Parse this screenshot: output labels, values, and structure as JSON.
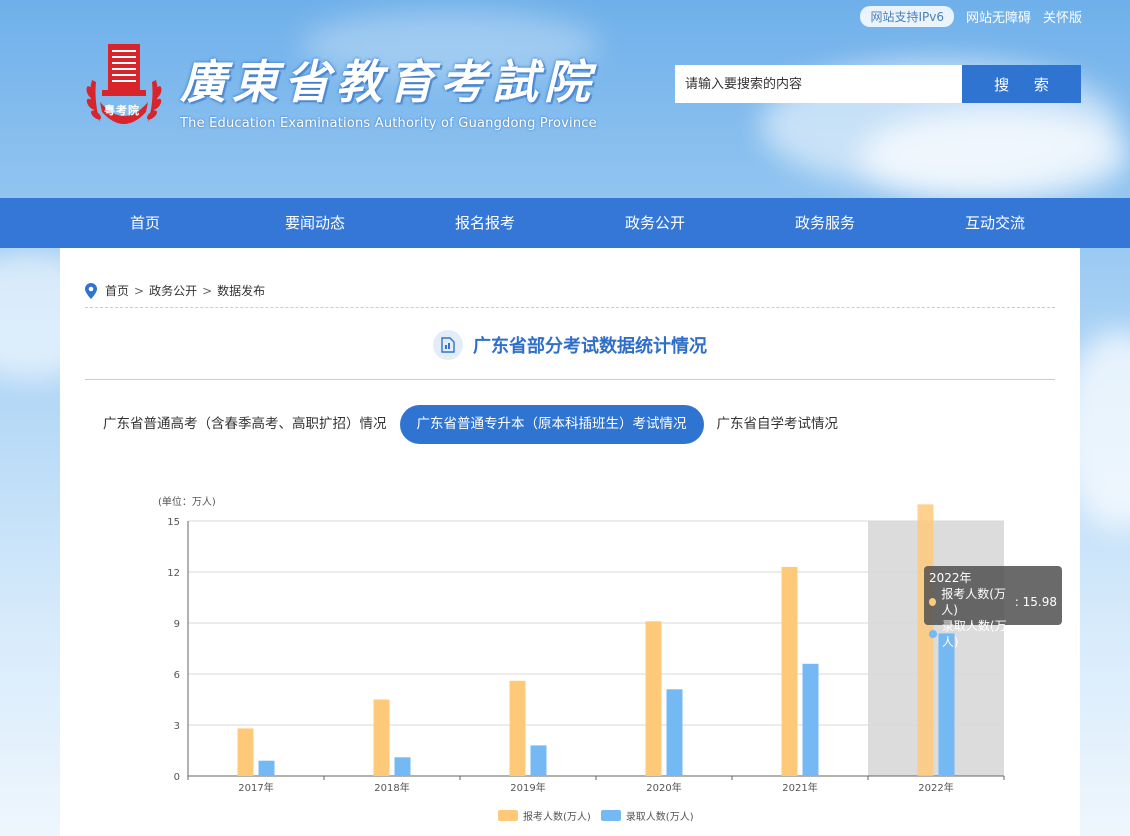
{
  "top_links": {
    "ipv6": "网站支持IPv6",
    "accessibility": "网站无障碍",
    "elderly": "关怀版"
  },
  "brand": {
    "seal_text": "粤考院",
    "name_cn": "廣東省教育考試院",
    "name_en": "The Education Examinations Authority of Guangdong Province"
  },
  "search": {
    "placeholder": "请输入要搜索的内容",
    "button": "搜 索"
  },
  "nav": {
    "items": [
      "首页",
      "要闻动态",
      "报名报考",
      "政务公开",
      "政务服务",
      "互动交流"
    ]
  },
  "breadcrumb": {
    "items": [
      "首页",
      "政务公开",
      "数据发布"
    ],
    "separator": ">"
  },
  "page": {
    "title": "广东省部分考试数据统计情况"
  },
  "tabs": [
    {
      "label": "广东省普通高考（含春季高考、高职扩招）情况",
      "active": false
    },
    {
      "label": "广东省普通专升本（原本科插班生）考试情况",
      "active": true
    },
    {
      "label": "广东省自学考试情况",
      "active": false
    }
  ],
  "colors": {
    "nav": "#3477d6",
    "accent": "#2f74d0",
    "series_applicants": "#ffc97a",
    "series_admitted": "#74b9f3",
    "highlight_band": "#dcdcdc"
  },
  "chart_data": {
    "type": "bar",
    "unit_label": "(单位：万人)",
    "categories": [
      "2017年",
      "2018年",
      "2019年",
      "2020年",
      "2021年",
      "2022年"
    ],
    "series": [
      {
        "name": "报考人数(万人)",
        "values": [
          2.8,
          4.5,
          5.6,
          9.1,
          12.3,
          15.98
        ]
      },
      {
        "name": "录取人数(万人)",
        "values": [
          0.9,
          1.1,
          1.8,
          5.1,
          6.6,
          8.39
        ]
      }
    ],
    "ylim": [
      0,
      15
    ],
    "yticks": [
      0,
      3,
      6,
      9,
      12,
      15
    ],
    "grid": true,
    "legend": "bottom",
    "highlighted_category": "2022年",
    "tooltip": {
      "title": "2022年",
      "rows": [
        {
          "label": "报考人数(万人)",
          "value": "15.98"
        },
        {
          "label": "录取人数(万人)",
          "value": "8.39"
        }
      ]
    }
  }
}
